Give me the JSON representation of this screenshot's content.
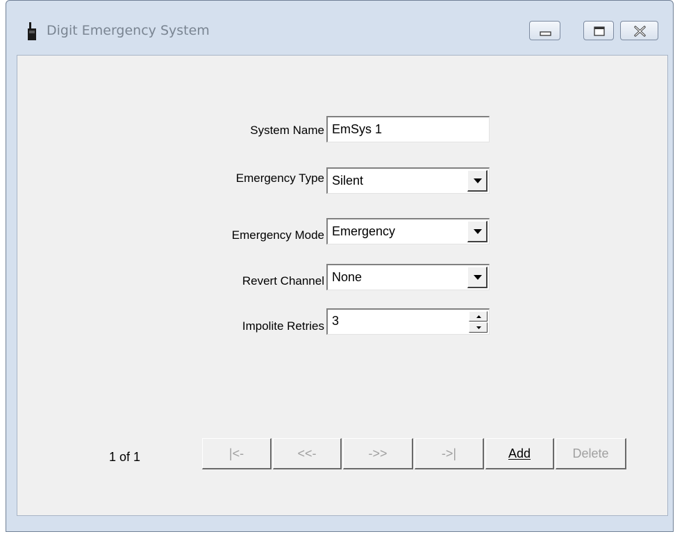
{
  "window": {
    "title": "Digit Emergency System",
    "icon": "radio-icon",
    "controls": [
      "minimize-icon",
      "maximize-icon",
      "close-icon"
    ]
  },
  "form": {
    "system_name": {
      "label": "System Name",
      "value": "EmSys 1"
    },
    "emergency_type": {
      "label": "Emergency Type",
      "value": "Silent"
    },
    "emergency_mode": {
      "label": "Emergency Mode",
      "value": "Emergency"
    },
    "revert_channel": {
      "label": "Revert Channel",
      "value": "None"
    },
    "impolite_retries": {
      "label": "Impolite Retries",
      "value": "3"
    }
  },
  "navigation": {
    "record_counter": "1 of 1",
    "first_label": "|<-",
    "prev_label": "<<-",
    "next_label": "->>",
    "last_label": "->|",
    "add_label": "Add",
    "delete_label": "Delete"
  },
  "colors": {
    "window_frame": "#d5e0ee",
    "client_bg": "#f0f0f0",
    "disabled_text": "#a0a0a0",
    "title_text": "#7a8592"
  }
}
